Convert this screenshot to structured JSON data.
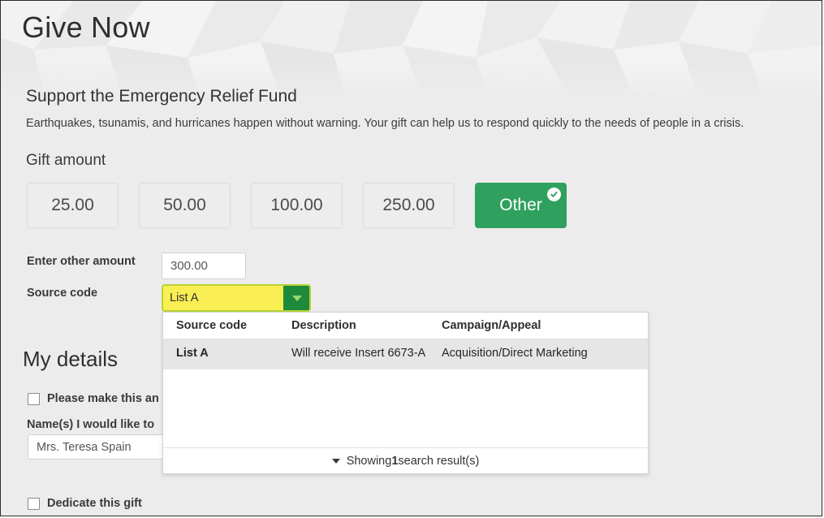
{
  "header": {
    "title": "Give Now"
  },
  "intro": {
    "heading": "Support the Emergency Relief Fund",
    "body": "Earthquakes, tsunamis, and hurricanes happen without warning. Your gift can help us to respond quickly to the needs of people in a crisis."
  },
  "gift": {
    "label": "Gift amount",
    "options": [
      {
        "label": "25.00",
        "selected": false
      },
      {
        "label": "50.00",
        "selected": false
      },
      {
        "label": "100.00",
        "selected": false
      },
      {
        "label": "250.00",
        "selected": false
      },
      {
        "label": "Other",
        "selected": true
      }
    ],
    "selected_badge_icon": "check-circle-icon",
    "other_amount": {
      "label": "Enter other amount",
      "value": "300.00",
      "placeholder": ""
    },
    "source_code": {
      "label": "Source code",
      "value": "List A",
      "placeholder": "",
      "toggle_icon": "chevron-down-icon"
    }
  },
  "source_code_dropdown": {
    "columns": [
      "Source code",
      "Description",
      "Campaign/Appeal"
    ],
    "rows": [
      {
        "code": "List A",
        "description": "Will receive Insert 6673-A",
        "campaign": "Acquisition/Direct Marketing"
      }
    ],
    "footer": {
      "icon": "triangle-down-icon",
      "prefix": "Showing ",
      "count": "1",
      "suffix": " search result(s)"
    }
  },
  "details": {
    "title": "My details",
    "anonymous_checkbox": "Please make this an",
    "names_label": "Name(s) I would like to",
    "donor_name": {
      "value": "Mrs. Teresa Spain",
      "placeholder": ""
    },
    "dedicate_checkbox": "Dedicate this gift"
  },
  "colors": {
    "accent_green": "#2fa05e",
    "toggle_green": "#1e8a3c",
    "highlight_yellow": "#f9ee53",
    "highlight_border": "#b8d437",
    "page_background": "#ececec",
    "row_highlight": "#e6e6e6"
  }
}
